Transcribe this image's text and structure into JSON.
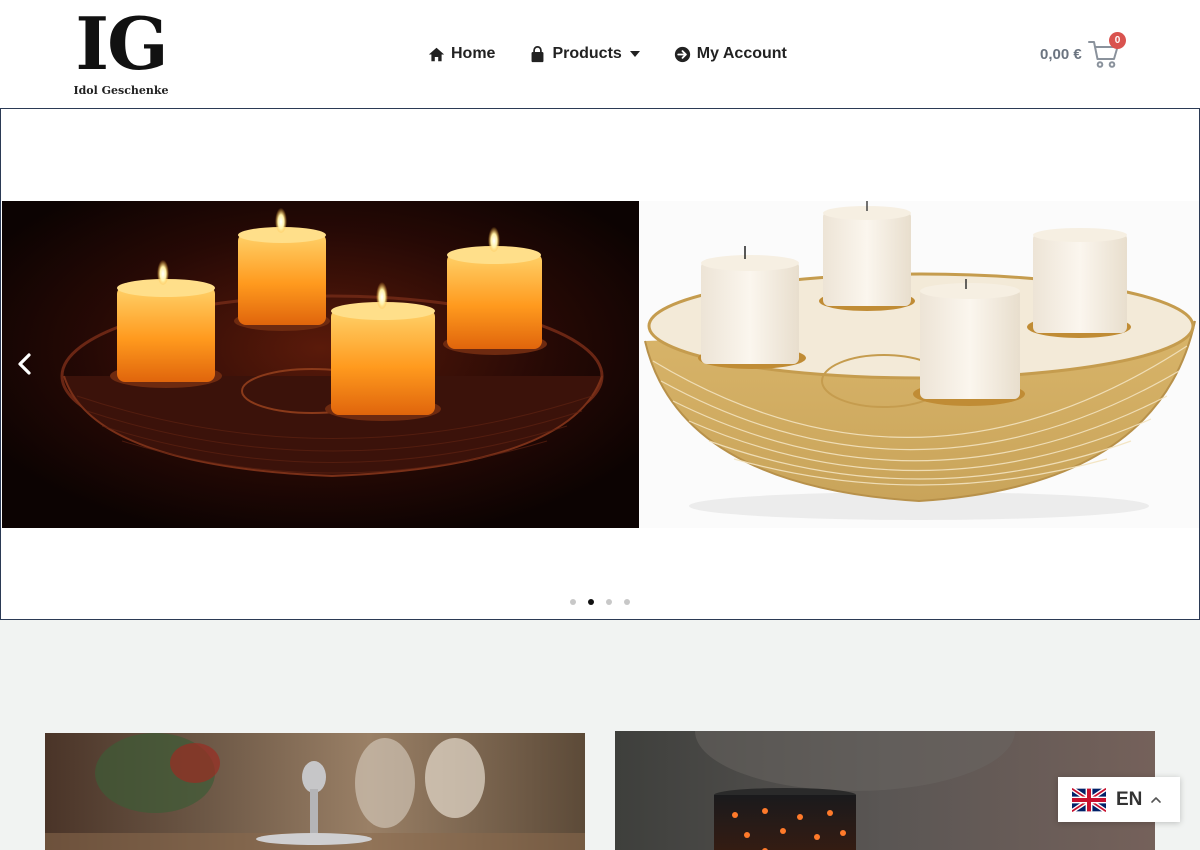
{
  "header": {
    "logo": {
      "mark": "IG",
      "name": "Idol Geschenke"
    },
    "nav": [
      {
        "label": "Home",
        "icon": "home-icon"
      },
      {
        "label": "Products",
        "icon": "shopping-bag-icon",
        "has_dropdown": true
      },
      {
        "label": "My Account",
        "icon": "arrow-circle-right-icon"
      }
    ],
    "cart": {
      "total": "0,00 €",
      "count": "0",
      "icon": "cart-icon"
    }
  },
  "slider": {
    "slides": [
      {
        "image": "lit-candles-in-wire-bowl"
      },
      {
        "image": "white-candles-in-gold-wire-bowl"
      }
    ],
    "prev_icon": "chevron-left-icon",
    "dots": 4,
    "active_dot": 1
  },
  "categories": [
    {
      "image": "silver-tiered-stand-photo"
    },
    {
      "image": "star-lantern-candle-photo"
    }
  ],
  "language": {
    "code": "EN",
    "flag": "uk-flag-icon",
    "chevron": "chevron-up-icon"
  },
  "colors": {
    "cart_badge": "#d9534f",
    "slider_border": "#2b3a55",
    "section_bg": "#f1f3f2"
  }
}
